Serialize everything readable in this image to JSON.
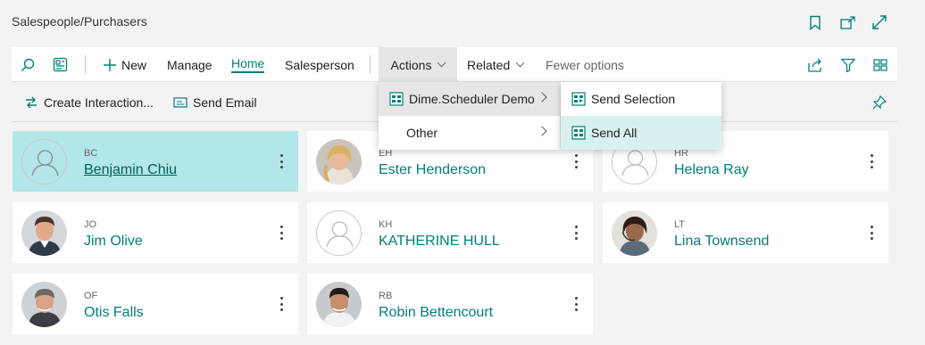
{
  "page": {
    "title": "Salespeople/Purchasers"
  },
  "title_icons": [
    "bookmark-icon",
    "open-in-new-window-icon",
    "expand-icon"
  ],
  "actionbar": {
    "new_label": "New",
    "manage_label": "Manage",
    "home_label": "Home",
    "salesperson_label": "Salesperson",
    "actions_label": "Actions",
    "related_label": "Related",
    "fewer_options_label": "Fewer options",
    "accent_color": "#00807a"
  },
  "subbar": {
    "create_interaction_label": "Create Interaction...",
    "send_email_label": "Send Email"
  },
  "actions_menu": {
    "items": [
      {
        "label": "Dime.Scheduler Demo"
      },
      {
        "label": "Other"
      }
    ]
  },
  "submenu": {
    "items": [
      {
        "label": "Send Selection"
      },
      {
        "label": "Send All"
      }
    ]
  },
  "cards": [
    {
      "initials": "BC",
      "name": "Benjamin Chiu",
      "selected": true
    },
    {
      "initials": "EH",
      "name": "Ester Henderson"
    },
    {
      "initials": "HR",
      "name": "Helena Ray"
    },
    {
      "initials": "JO",
      "name": "Jim Olive"
    },
    {
      "initials": "KH",
      "name": "KATHERINE HULL"
    },
    {
      "initials": "LT",
      "name": "Lina Townsend"
    },
    {
      "initials": "OF",
      "name": "Otis Falls"
    },
    {
      "initials": "RB",
      "name": "Robin Bettencourt"
    }
  ]
}
